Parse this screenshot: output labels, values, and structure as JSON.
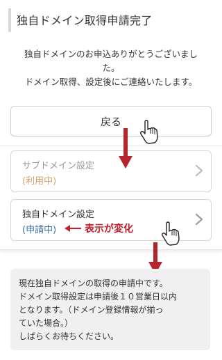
{
  "header": {
    "title": "独自ドメイン取得申請完了"
  },
  "message": {
    "line1": "独自ドメインのお申込ありがとうございまし",
    "line2": "た。",
    "line3": "ドメイン取得、設定後にご連絡いたします。"
  },
  "back_button": {
    "label": "戻る"
  },
  "settings": {
    "items": [
      {
        "title": "サブドメイン設定",
        "status": "(利用中)",
        "disabled": true
      },
      {
        "title": "独自ドメイン設定",
        "status": "(申請中)",
        "disabled": false
      }
    ]
  },
  "annotation": {
    "text": "表示が変化"
  },
  "info_box": {
    "line1": "現在独自ドメインの取得の申請中です。",
    "line2": "ドメイン取得設定は申請後１０営業日以内",
    "line3": "となります。（ドメイン登録情報が揃っ",
    "line4": "ていた場合。）",
    "line5": "しばらくお待ちください。"
  },
  "colors": {
    "annotation_red": "#c0212b",
    "status_in_use": "#d9a06a",
    "status_applying": "#3d6fa3",
    "arrow_red": "#b5262c"
  },
  "icons": [
    "chevron-right-icon",
    "hand-pointer-icon",
    "arrow-down-icon",
    "arrow-left-icon"
  ]
}
